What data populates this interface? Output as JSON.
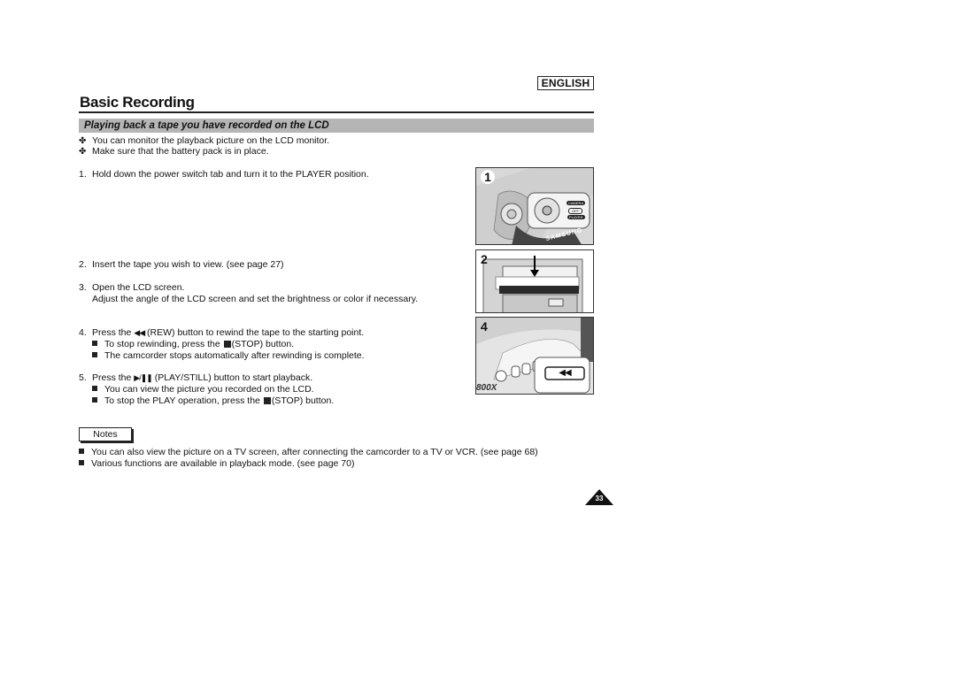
{
  "header": {
    "language": "ENGLISH",
    "title": "Basic Recording"
  },
  "section": {
    "title": "Playing back a tape you have recorded on the LCD"
  },
  "intro_bullets": [
    "You can monitor the playback picture on the LCD monitor.",
    "Make sure that the battery pack is in place."
  ],
  "steps": [
    {
      "num": "1.",
      "text": "Hold down the power switch tab and turn it to the PLAYER position."
    },
    {
      "num": "2.",
      "text": "Insert the tape you wish to view. (see page 27)"
    },
    {
      "num": "3.",
      "text": "Open the LCD screen.",
      "text2": "Adjust the angle of the LCD screen and set the brightness or color if necessary."
    },
    {
      "num": "4.",
      "pre": "Press the",
      "icon": "rewind-icon",
      "glyph": "◀◀",
      "post": "(REW) button to rewind the tape to the starting point.",
      "subs": [
        {
          "pre": "To stop rewinding, press the",
          "post": "(STOP) button."
        },
        {
          "text": "The camcorder stops automatically after rewinding is complete."
        }
      ]
    },
    {
      "num": "5.",
      "pre": "Press the",
      "icon": "play-pause-icon",
      "glyph": "▶/❚❚",
      "post": "(PLAY/STILL) button to start playback.",
      "subs": [
        {
          "text": "You can view the picture you recorded on the LCD."
        },
        {
          "pre": "To stop the PLAY operation, press the",
          "post": "(STOP) button."
        }
      ]
    }
  ],
  "figures": [
    {
      "label": "1",
      "dial_labels": [
        "CAMERA",
        "OFF",
        "PLAYER"
      ],
      "brand": "SAMSUNG"
    },
    {
      "label": "2"
    },
    {
      "label": "4",
      "button_glyph": "◀◀"
    }
  ],
  "notes": {
    "label": "Notes",
    "items": [
      "You can also view the picture on a TV screen, after connecting the camcorder to a TV or VCR. (see page 68)",
      "Various functions are available in playback mode. (see page 70)"
    ]
  },
  "page_number": "33"
}
